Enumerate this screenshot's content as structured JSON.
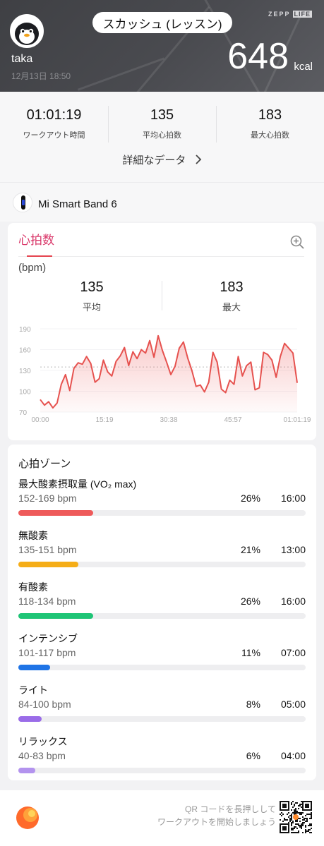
{
  "header": {
    "sport": "スカッシュ (レッスン)",
    "username": "taka",
    "datetime": "12月13日 18:50",
    "brand_main": "ZEPP",
    "brand_sub": "LIFE",
    "calories": "648",
    "calories_unit": "kcal"
  },
  "summary": {
    "stats": [
      {
        "value": "01:01:19",
        "label": "ワークアウト時間"
      },
      {
        "value": "135",
        "label": "平均心拍数"
      },
      {
        "value": "183",
        "label": "最大心拍数"
      }
    ],
    "detail_link": "詳細なデータ"
  },
  "device": {
    "name": "Mi Smart Band 6"
  },
  "heart_rate": {
    "title": "心拍数",
    "unit": "(bpm)",
    "average": {
      "value": "135",
      "label": "平均"
    },
    "max": {
      "value": "183",
      "label": "最大"
    }
  },
  "chart_data": {
    "type": "area",
    "xlabel": "",
    "ylabel": "(bpm)",
    "ylim": [
      70,
      190
    ],
    "yticks": [
      "190",
      "160",
      "130",
      "100",
      "70"
    ],
    "xticks": [
      "00:00",
      "15:19",
      "30:38",
      "45:57",
      "01:01:19"
    ],
    "average_line": 135,
    "x_minutes": [
      0,
      1,
      2,
      3,
      4,
      5,
      6,
      7,
      8,
      9,
      10,
      11,
      12,
      13,
      14,
      15,
      16,
      17,
      18,
      19,
      20,
      21,
      22,
      23,
      24,
      25,
      26,
      27,
      28,
      29,
      30,
      31,
      32,
      33,
      34,
      35,
      36,
      37,
      38,
      39,
      40,
      41,
      42,
      43,
      44,
      45,
      46,
      47,
      48,
      49,
      50,
      51,
      52,
      53,
      54,
      55,
      56,
      57,
      58,
      59,
      60,
      61
    ],
    "values": [
      88,
      80,
      85,
      76,
      83,
      110,
      124,
      101,
      133,
      141,
      139,
      150,
      140,
      113,
      118,
      145,
      128,
      122,
      143,
      151,
      163,
      137,
      157,
      147,
      160,
      155,
      173,
      149,
      180,
      159,
      142,
      124,
      136,
      162,
      171,
      148,
      130,
      107,
      109,
      99,
      113,
      156,
      142,
      103,
      98,
      116,
      110,
      150,
      122,
      137,
      142,
      102,
      105,
      156,
      153,
      145,
      120,
      150,
      169,
      162,
      155,
      112
    ]
  },
  "zones": {
    "title": "心拍ゾーン",
    "items": [
      {
        "name": "最大酸素摂取量 (VO₂ max)",
        "range": "152-169 bpm",
        "percent": "26%",
        "time": "16:00",
        "fill": 0.26,
        "color": "#ee5a5a"
      },
      {
        "name": "無酸素",
        "range": "135-151 bpm",
        "percent": "21%",
        "time": "13:00",
        "fill": 0.21,
        "color": "#f5ad17"
      },
      {
        "name": "有酸素",
        "range": "118-134 bpm",
        "percent": "26%",
        "time": "16:00",
        "fill": 0.26,
        "color": "#1fc576"
      },
      {
        "name": "インテンシブ",
        "range": "101-117 bpm",
        "percent": "11%",
        "time": "07:00",
        "fill": 0.11,
        "color": "#1f74e6"
      },
      {
        "name": "ライト",
        "range": "84-100 bpm",
        "percent": "8%",
        "time": "05:00",
        "fill": 0.08,
        "color": "#9a6ce8"
      },
      {
        "name": "リラックス",
        "range": "40-83 bpm",
        "percent": "6%",
        "time": "04:00",
        "fill": 0.06,
        "color": "#b393ee"
      }
    ]
  },
  "footer": {
    "qr_line1": "QR コードを長押しして",
    "qr_line2": "ワークアウトを開始しましょう"
  }
}
